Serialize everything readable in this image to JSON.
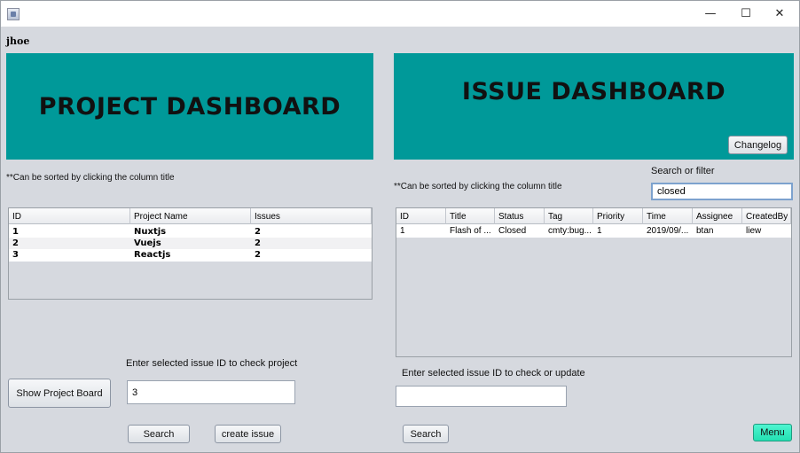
{
  "window": {
    "minimize": "—",
    "maximize": "☐",
    "close": "✕"
  },
  "user": "jhoe",
  "project": {
    "banner": "PROJECT DASHBOARD",
    "sort_note": "**Can be sorted by clicking the column title",
    "columns": [
      "ID",
      "Project Name",
      "Issues"
    ],
    "rows": [
      [
        "1",
        "Nuxtjs",
        "2"
      ],
      [
        "2",
        "Vuejs",
        "2"
      ],
      [
        "3",
        "Reactjs",
        "2"
      ]
    ],
    "id_prompt": "Enter selected issue ID to check project",
    "id_value": "3",
    "show_board_button": "Show Project Board",
    "search_button": "Search",
    "create_button": "create issue"
  },
  "issue": {
    "banner": "ISSUE DASHBOARD",
    "changelog_button": "Changelog",
    "filter_label": "Search or filter",
    "filter_value": "closed",
    "sort_note": "**Can be sorted by clicking the column title",
    "columns": [
      "ID",
      "Title",
      "Status",
      "Tag",
      "Priority",
      "Time",
      "Assignee",
      "CreatedBy"
    ],
    "rows": [
      [
        "1",
        "Flash of ...",
        "Closed",
        "cmty:bug...",
        "1",
        "2019/09/...",
        "btan",
        "liew"
      ]
    ],
    "id_prompt": "Enter selected issue ID to check or update",
    "id_value": "",
    "search_button": "Search",
    "menu_button": "Menu"
  },
  "colors": {
    "banner": "#009999",
    "menu_button": "#23e0b2",
    "window_bg": "#d6d9df"
  }
}
